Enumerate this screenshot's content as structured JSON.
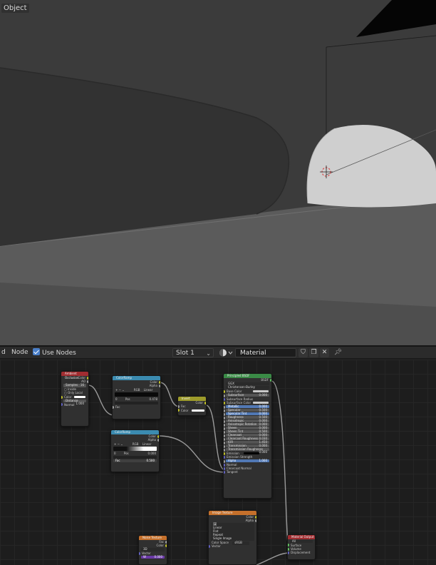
{
  "viewport": {
    "mode_label": "Object"
  },
  "node_editor_header": {
    "menu_cut": "d",
    "menu_node": "Node",
    "use_nodes_label": "Use Nodes",
    "use_nodes_checked": true,
    "slot_value": "Slot 1",
    "material_name": "Material"
  },
  "nodes": {
    "ambient_occlusion": {
      "title": "Ambient Occlusion",
      "header_color": "#a12d31",
      "outputs": [
        "Color",
        "AO"
      ],
      "samples_label": "Samples",
      "samples_value": "16",
      "options": [
        "Inside",
        "Only Local"
      ],
      "color_label": "Color",
      "distance_label": "Distance",
      "distance_value": "1.000",
      "normal_label": "Normal"
    },
    "color_ramp_1": {
      "title": "ColorRamp",
      "header_color": "#3b8bb0",
      "outputs": [
        "Color",
        "Alpha"
      ],
      "mode": "RGB",
      "interp": "Linear",
      "pos_label": "Pos",
      "pos_value": "0.478",
      "index_value": "0",
      "fac_label": "Fac"
    },
    "invert": {
      "title": "Invert",
      "header_color": "#9d9b2b",
      "output": "Color",
      "fac_label": "Fac",
      "color_label": "Color"
    },
    "color_ramp_2": {
      "title": "ColorRamp",
      "header_color": "#3b8bb0",
      "outputs": [
        "Color",
        "Alpha"
      ],
      "mode": "RGB",
      "interp": "Linear",
      "pos_label": "Pos",
      "pos_value": "0.000",
      "index_value": "0",
      "fac_label": "Fac",
      "fac_value": "0.500"
    },
    "principled": {
      "title": "Principled BSDF",
      "header_color": "#3a8a46",
      "output": "BSDF",
      "distribution": "GGX",
      "subsurface_method": "Christensen-Burley",
      "rows": [
        {
          "label": "Base Color",
          "value": ""
        },
        {
          "label": "Subsurface",
          "value": "0.000"
        },
        {
          "label": "Subsurface Radius",
          "value": ""
        },
        {
          "label": "Subsurface Color",
          "value": ""
        },
        {
          "label": "Metallic",
          "value": "0.000"
        },
        {
          "label": "Specular",
          "value": "0.500"
        },
        {
          "label": "Specular Tint",
          "value": "0.000"
        },
        {
          "label": "Roughness",
          "value": "0.500"
        },
        {
          "label": "Anisotropic",
          "value": "0.000"
        },
        {
          "label": "Anisotropic Rotation",
          "value": "0.000"
        },
        {
          "label": "Sheen",
          "value": "0.000"
        },
        {
          "label": "Sheen Tint",
          "value": "0.500"
        },
        {
          "label": "Clearcoat",
          "value": "0.000"
        },
        {
          "label": "Clearcoat Roughness",
          "value": "0.030"
        },
        {
          "label": "IOR",
          "value": "1.450"
        },
        {
          "label": "Transmission",
          "value": "0.000"
        },
        {
          "label": "Transmission Roughness",
          "value": "0.000"
        },
        {
          "label": "Emission",
          "value": ""
        },
        {
          "label": "Emission Strength",
          "value": ""
        },
        {
          "label": "Alpha",
          "value": "1.000"
        },
        {
          "label": "Normal",
          "value": ""
        },
        {
          "label": "Clearcoat Normal",
          "value": ""
        },
        {
          "label": "Tangent",
          "value": ""
        }
      ]
    },
    "image_texture": {
      "title": "Image Texture",
      "header_color": "#c5702b",
      "outputs": [
        "Color",
        "Alpha"
      ],
      "image_name": "",
      "options": [
        "Linear",
        "Flat",
        "Repeat",
        "Single Image"
      ],
      "color_space_label": "Color Space",
      "color_space_value": "sRGB",
      "vector_label": "Vector"
    },
    "noise_texture": {
      "title": "Noise Texture",
      "header_color": "#c5702b",
      "outputs": [
        "Fac",
        "Color"
      ],
      "dimensions": "3D",
      "vector_label": "Vector",
      "w_label": "W",
      "w_value": "0.000"
    },
    "material_output": {
      "title": "Material Output",
      "header_color": "#a12d31",
      "target": "All",
      "inputs": [
        "Surface",
        "Volume",
        "Displacement"
      ]
    }
  }
}
